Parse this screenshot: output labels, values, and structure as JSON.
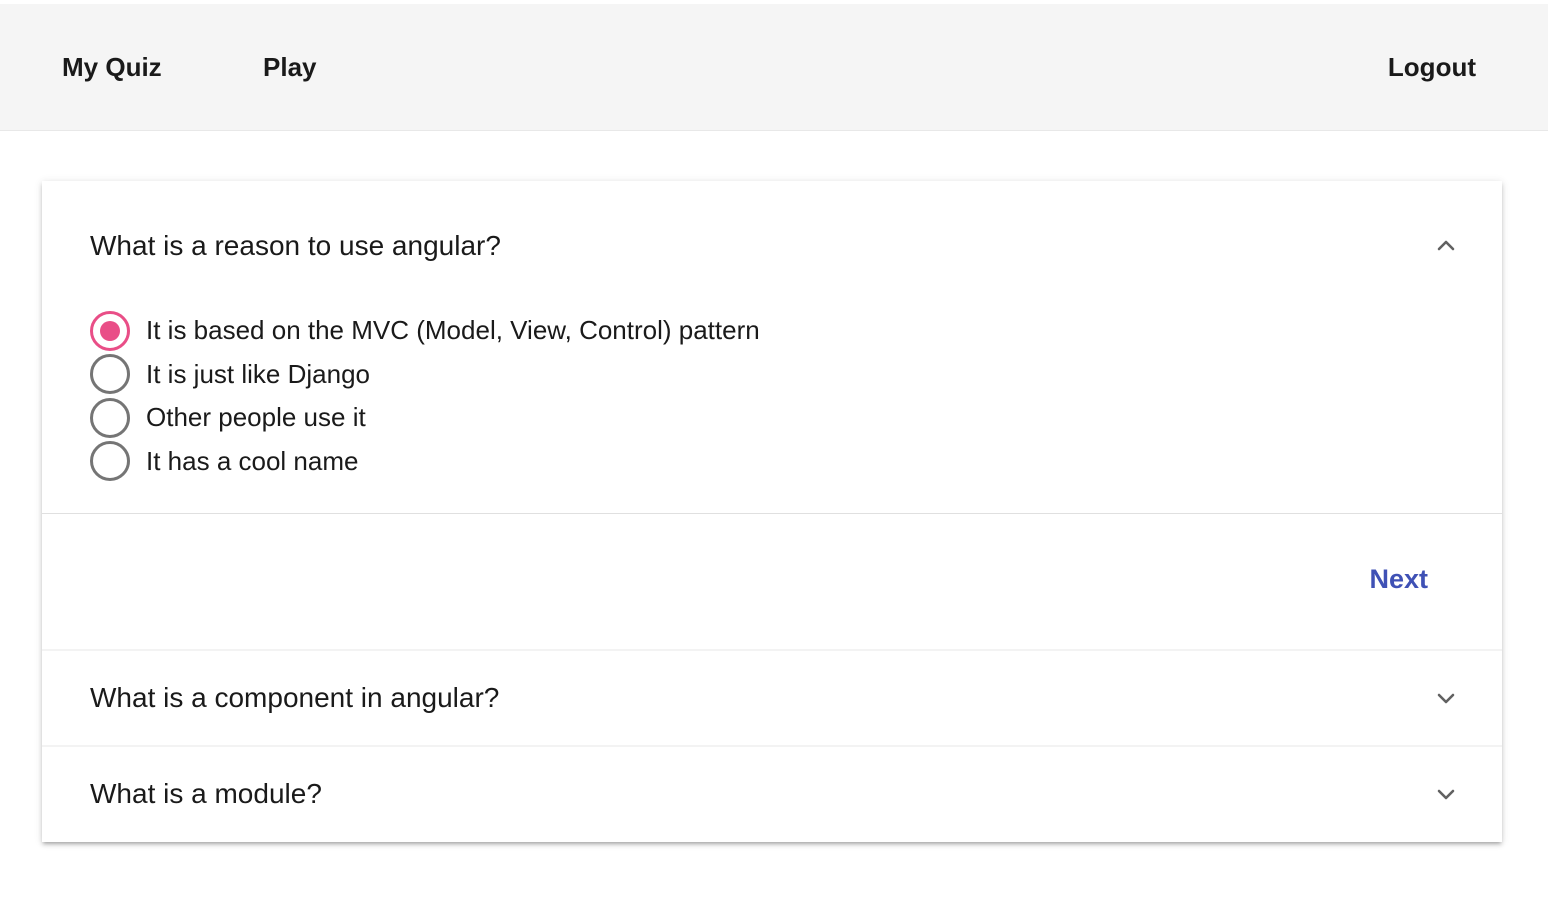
{
  "nav": {
    "my_quiz": "My Quiz",
    "play": "Play",
    "logout": "Logout"
  },
  "accordion": {
    "panels": [
      {
        "question": "What is a reason to use angular?",
        "expanded": true,
        "icon": "chevron-up-icon",
        "options": [
          {
            "label": "It is based on the MVC (Model, View, Control) pattern",
            "selected": true
          },
          {
            "label": "It is just like Django",
            "selected": false
          },
          {
            "label": "Other people use it",
            "selected": false
          },
          {
            "label": "It has a cool name",
            "selected": false
          }
        ],
        "action_label": "Next"
      },
      {
        "question": "What is a component in angular?",
        "expanded": false,
        "icon": "chevron-down-icon"
      },
      {
        "question": "What is a module?",
        "expanded": false,
        "icon": "chevron-down-icon"
      }
    ]
  },
  "colors": {
    "accent": "#e94e87",
    "primary": "#3f51b5",
    "topbar_bg": "#f5f5f5"
  }
}
